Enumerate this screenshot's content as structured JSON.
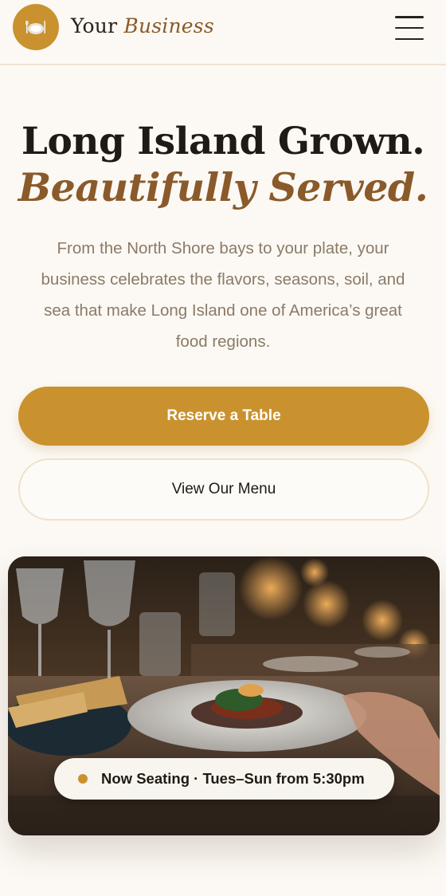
{
  "header": {
    "logo_icon": "plate-with-cutlery-icon",
    "brand_plain": "Your",
    "brand_italic": "Business",
    "menu_icon": "hamburger-menu-icon"
  },
  "hero": {
    "title": "Long Island Grown.",
    "title_accent": "Beautifully Served.",
    "description": "From the North Shore bays to your plate, your business celebrates the flavors, seasons, soil, and sea that make Long Island one of America’s great food regions."
  },
  "actions": {
    "primary_label": "Reserve a Table",
    "secondary_label": "View Our Menu"
  },
  "photo": {
    "status_text": "Now Seating · Tues–Sun from 5:30pm"
  },
  "colors": {
    "background": "#fcf9f4",
    "accent_gold": "#c9922f",
    "accent_brown": "#8a5a2b",
    "text_dark": "#1f1a14",
    "text_muted": "#8b7a68"
  }
}
